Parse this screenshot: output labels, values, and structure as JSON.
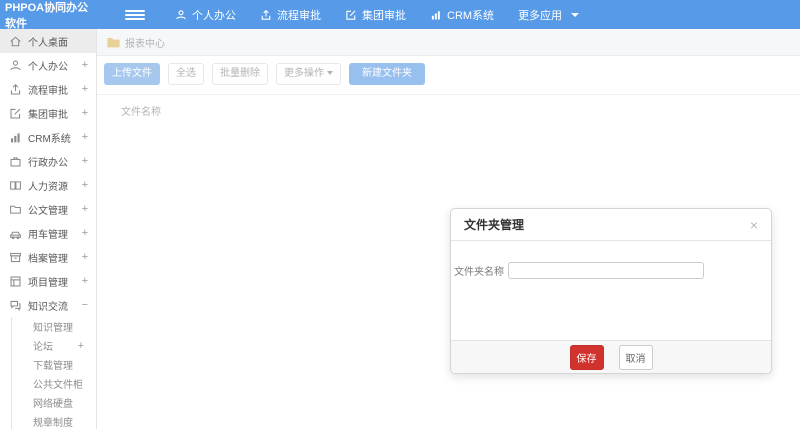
{
  "colors": {
    "navbar_bg": "#569ae8",
    "light_primary_button_bg": "#a6c8ef",
    "new_folder_button_bg": "#97c0ef",
    "save_button_bg": "#d2322d",
    "folder_icon": "#e9d096",
    "active_sidebar_bg": "#ececec"
  },
  "topnav": {
    "logo": "PHPOA协同办公软件",
    "items": [
      {
        "label": "个人办公"
      },
      {
        "label": "流程审批"
      },
      {
        "label": "集团审批"
      },
      {
        "label": "CRM系统"
      },
      {
        "label": "更多应用"
      }
    ]
  },
  "sidebar": {
    "items": [
      {
        "label": "个人桌面",
        "expander": ""
      },
      {
        "label": "个人办公",
        "expander": "+"
      },
      {
        "label": "流程审批",
        "expander": "+"
      },
      {
        "label": "集团审批",
        "expander": "+"
      },
      {
        "label": "CRM系统",
        "expander": "+"
      },
      {
        "label": "行政办公",
        "expander": "+"
      },
      {
        "label": "人力资源",
        "expander": "+"
      },
      {
        "label": "公文管理",
        "expander": "+"
      },
      {
        "label": "用车管理",
        "expander": "+"
      },
      {
        "label": "档案管理",
        "expander": "+"
      },
      {
        "label": "项目管理",
        "expander": "+"
      },
      {
        "label": "知识交流",
        "expander": "−"
      }
    ],
    "subitems": [
      {
        "label": "知识管理",
        "expander": ""
      },
      {
        "label": "论坛",
        "expander": "+"
      },
      {
        "label": "下载管理",
        "expander": ""
      },
      {
        "label": "公共文件柜",
        "expander": ""
      },
      {
        "label": "网络硬盘",
        "expander": ""
      },
      {
        "label": "规章制度",
        "expander": ""
      }
    ]
  },
  "content": {
    "breadcrumb": "报表中心",
    "toolbar": {
      "upload": "上传文件",
      "select_all": "全选",
      "batch_delete": "批量删除",
      "more_actions": "更多操作",
      "new_folder": "新建文件夹"
    },
    "table": {
      "header": "文件名称"
    }
  },
  "modal": {
    "title": "文件夹管理",
    "close": "×",
    "field_label": "文件夹名称",
    "input_value": "",
    "save": "保存",
    "cancel": "取消"
  }
}
